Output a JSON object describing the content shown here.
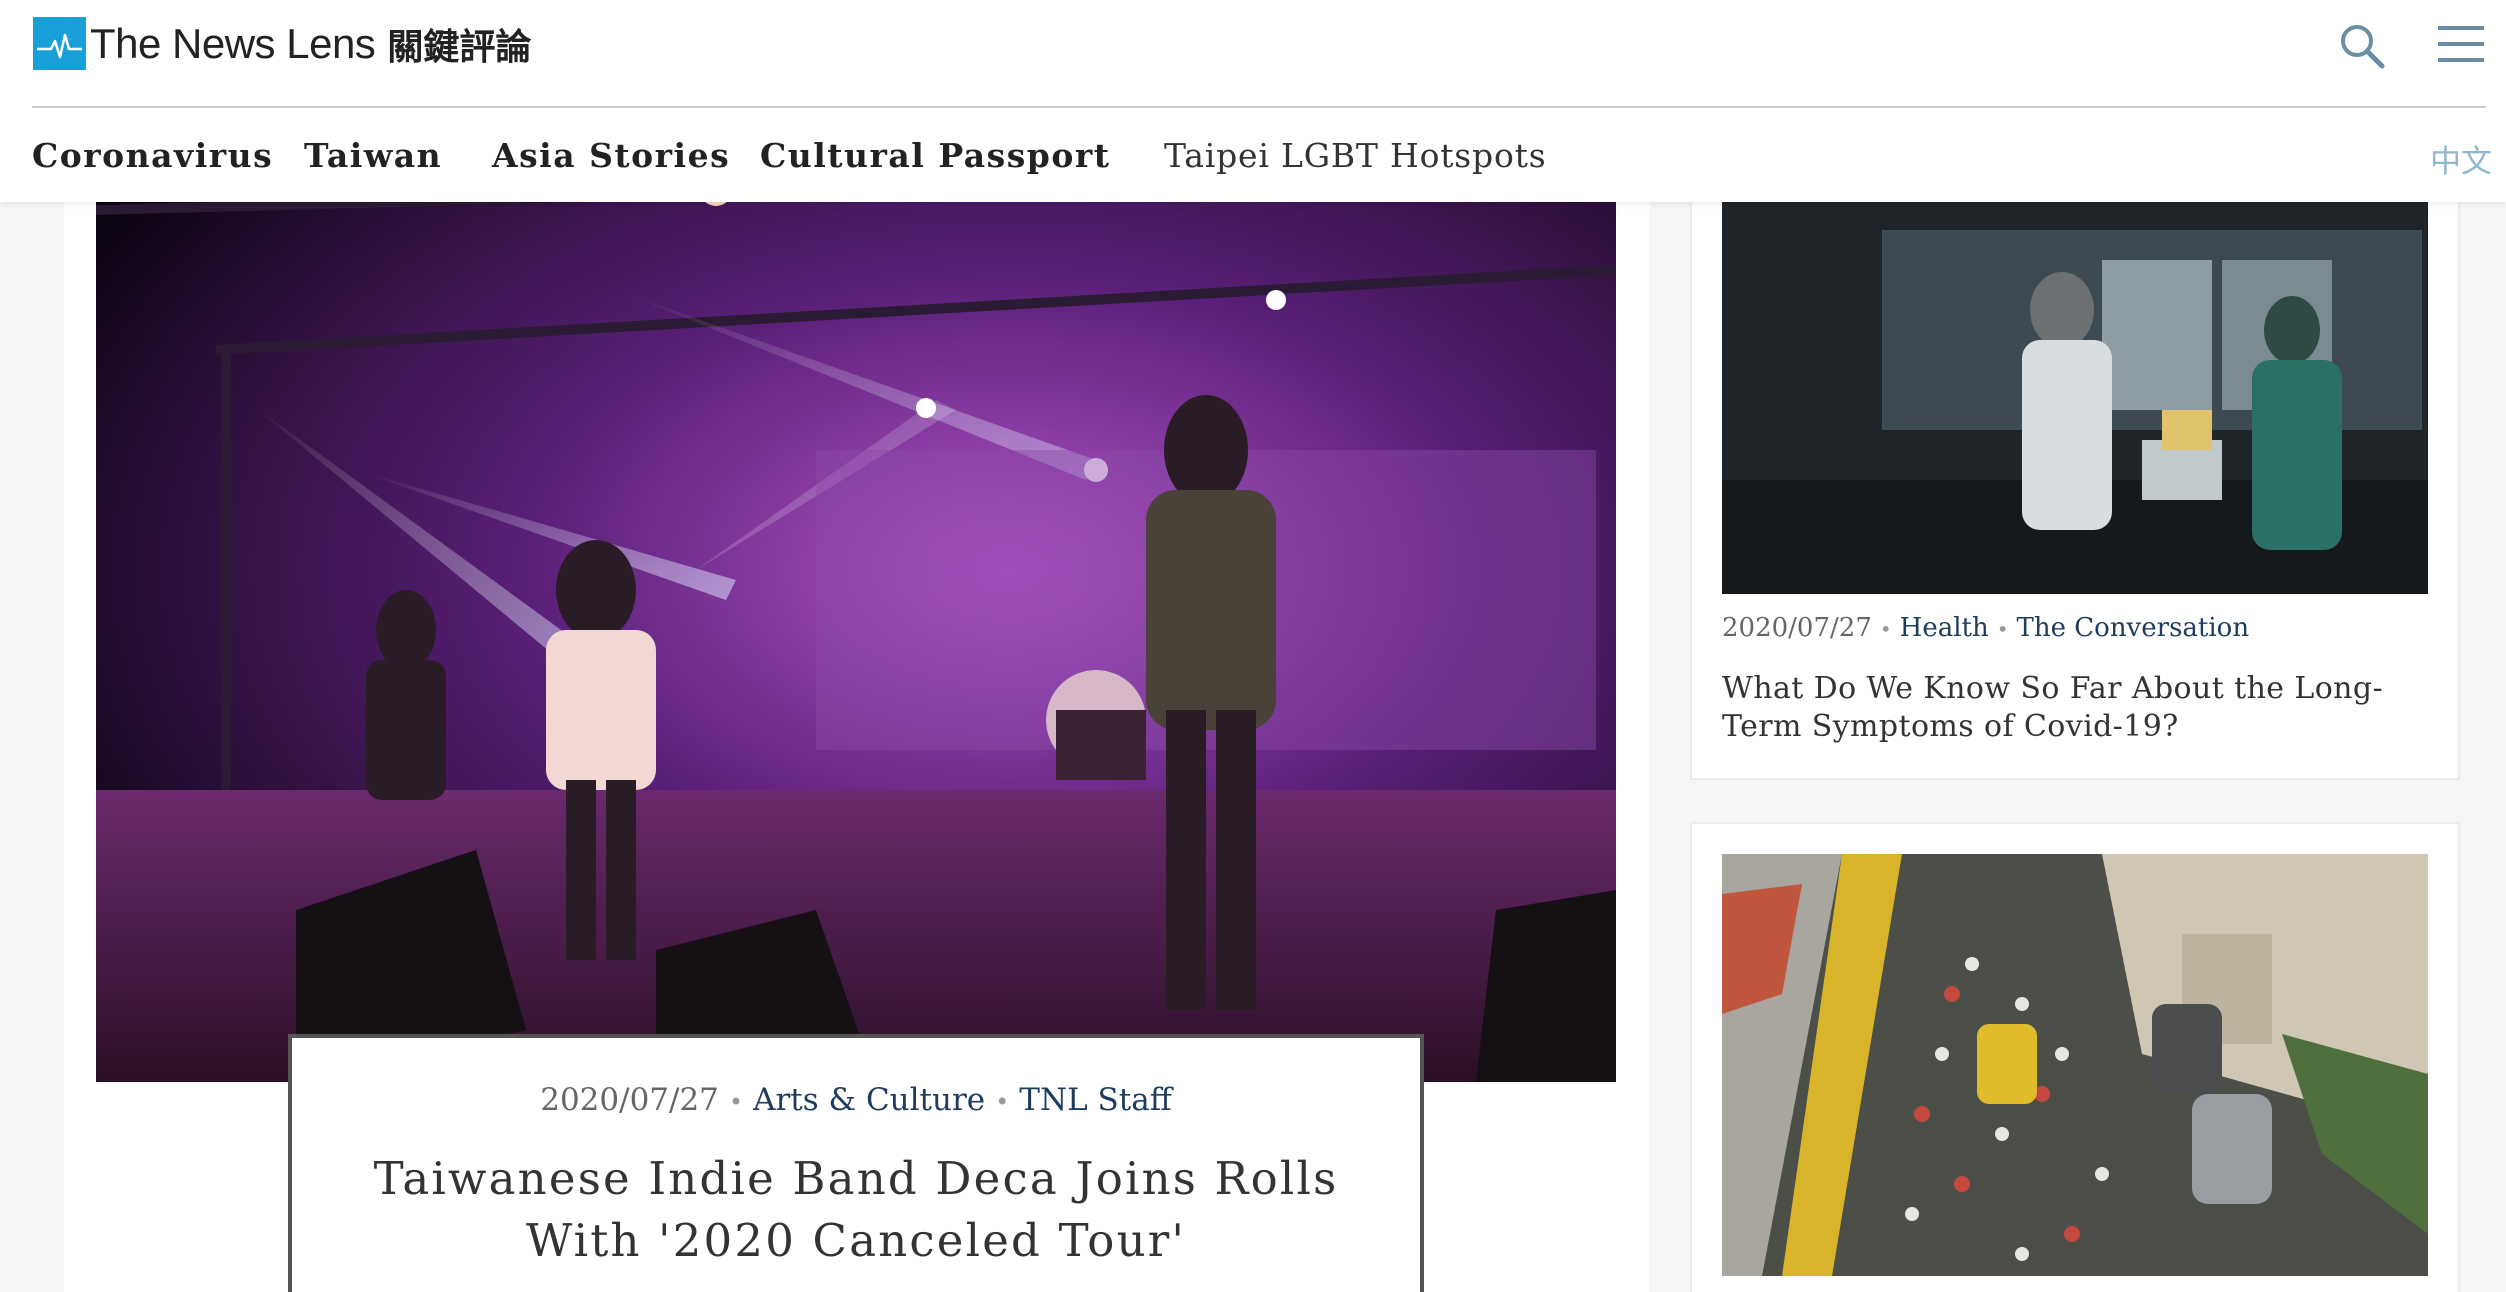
{
  "header": {
    "logo_text": "The News Lens",
    "logo_zh": "關鍵評論",
    "nav": [
      "Coronavirus",
      "Taiwan",
      "Asia Stories",
      "Cultural Passport"
    ],
    "nav_extra": "Taipei LGBT Hotspots",
    "lang": "中文"
  },
  "hero": {
    "date": "2020/07/27",
    "category": "Arts & Culture",
    "author": "TNL Staff",
    "headline": "Taiwanese Indie Band Deca Joins Rolls With '2020 Canceled Tour'",
    "image_alt": "Band performing on stage under purple lights"
  },
  "sidebar": [
    {
      "date": "2020/07/27",
      "category": "Health",
      "author": "The Conversation",
      "title": "What Do We Know So Far About the Long-Term Symptoms of Covid-19?"
    },
    {
      "image_alt": "Scooters and cars in heavy traffic"
    }
  ],
  "colors": {
    "accent": "#1aa0d8",
    "link": "#1d3c5e",
    "lang": "#8fb8cf"
  },
  "icons": [
    "search-icon",
    "menu-icon",
    "logo-pulse-icon"
  ]
}
